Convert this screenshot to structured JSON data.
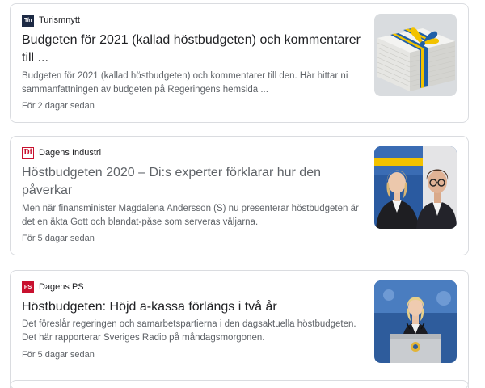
{
  "articles": [
    {
      "source": "Turismnytt",
      "favicon_icon": "turismnytt-logo-icon",
      "title": "Budgeten för 2021 (kallad höstbudgeten) och kommentarer till ...",
      "snippet": "Budgeten för 2021 (kallad höstbudgeten) och kommentarer till den. Här hittar ni sammanfattningen av budgeten på Regeringens hemsida ...",
      "date": "För 2 dagar sedan",
      "thumbnail_icon": "budget-documents-with-ribbon-image"
    },
    {
      "source": "Dagens Industri",
      "favicon_icon": "dagens-industri-logo-icon",
      "title": "Höstbudgeten 2020 – Di:s experter förklarar hur den påverkar",
      "snippet": "Men när finansminister Magdalena Andersson (S) nu presenterar höstbudgeten är det en äkta Gott och blandat-påse som serveras väljarna.",
      "date": "För 5 dagar sedan",
      "thumbnail_icon": "two-people-portrait-image"
    },
    {
      "source": "Dagens PS",
      "favicon_icon": "dagens-ps-logo-icon",
      "title": "Höstbudgeten: Höjd a-kassa förlängs i två år",
      "snippet": "Det föreslår regeringen och samarbetspartierna i den dagsaktuella höstbudgeten. Det här rapporterar Sveriges Radio på måndagsmorgonen.",
      "date": "För 5 dagar sedan",
      "thumbnail_icon": "speaker-at-podium-image"
    }
  ],
  "colors": {
    "title": "#202124",
    "title_visited": "#5f6368",
    "snippet": "#5f6368",
    "border": "#dadce0",
    "swedish_blue": "#1f5fa8",
    "swedish_yellow": "#f2c200"
  }
}
